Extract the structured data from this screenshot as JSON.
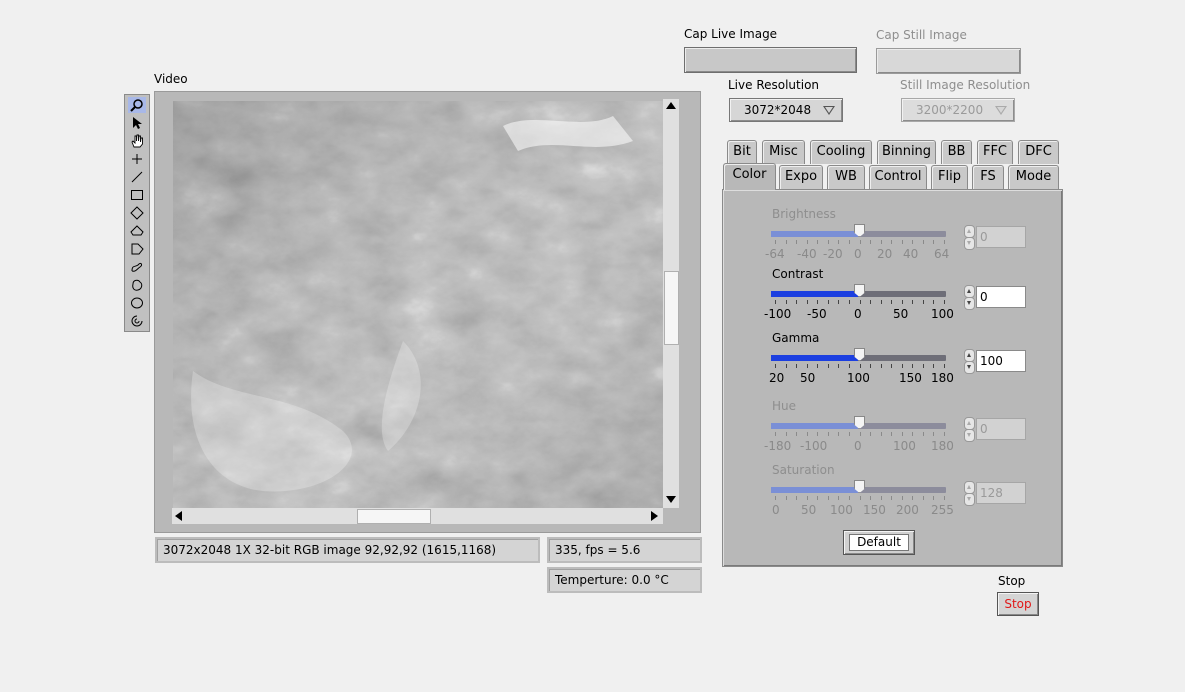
{
  "capture": {
    "live_label": "Cap Live Image",
    "still_label": "Cap Still Image",
    "live_resolution_label": "Live Resolution",
    "live_resolution_value": "3072*2048",
    "still_resolution_label": "Still Image Resolution",
    "still_resolution_value": "3200*2200"
  },
  "video": {
    "label": "Video",
    "tools": [
      "zoom-icon",
      "pointer-icon",
      "hand-icon",
      "crosshair-icon",
      "line-icon",
      "rectangle-icon",
      "rotated-rectangle-icon",
      "annulus-icon",
      "polygon-icon",
      "freehand-icon",
      "closed-freehand-icon",
      "oval-icon",
      "annulus-arc-icon"
    ],
    "info_text": "3072x2048 1X 32-bit RGB image 92,92,92     (1615,1168)",
    "fps_text": "335,  fps = 5.6",
    "temp_text": "Temperture:  0.0 °C"
  },
  "tabs": {
    "row1": [
      "Bit",
      "Misc",
      "Cooling",
      "Binning",
      "BB",
      "FFC",
      "DFC"
    ],
    "row2": [
      "Color",
      "Expo",
      "WB",
      "Control",
      "Flip",
      "FS",
      "Mode"
    ],
    "active": "Color"
  },
  "color": {
    "brightness": {
      "label": "Brightness",
      "value": "0",
      "min": -64,
      "max": 64,
      "scale": [
        "-64",
        "-40",
        "-20",
        "0",
        "20",
        "40",
        "64"
      ],
      "enabled": false
    },
    "contrast": {
      "label": "Contrast",
      "value": "0",
      "min": -100,
      "max": 100,
      "scale": [
        "-100",
        "-50",
        "0",
        "50",
        "100"
      ],
      "enabled": true
    },
    "gamma": {
      "label": "Gamma",
      "value": "100",
      "min": 20,
      "max": 180,
      "scale": [
        "20",
        "50",
        "100",
        "150",
        "180"
      ],
      "enabled": true
    },
    "hue": {
      "label": "Hue",
      "value": "0",
      "min": -180,
      "max": 180,
      "scale": [
        "-180",
        "-100",
        "0",
        "100",
        "180"
      ],
      "enabled": false
    },
    "saturation": {
      "label": "Saturation",
      "value": "128",
      "min": 0,
      "max": 255,
      "scale": [
        "0",
        "50",
        "100",
        "150",
        "200",
        "255"
      ],
      "enabled": false
    },
    "default_label": "Default"
  },
  "stop": {
    "label": "Stop",
    "button": "Stop"
  },
  "colors": {
    "accent_blue": "#1c3fe0",
    "disabled_blue": "#7a8fd6",
    "stop_red": "#e01818"
  }
}
